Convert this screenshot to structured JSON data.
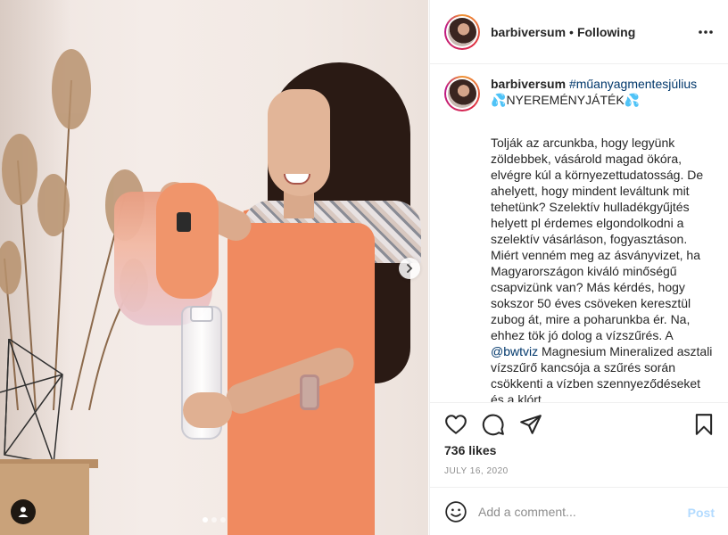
{
  "post": {
    "username": "barbiversum",
    "separator": "•",
    "follow_status": "Following",
    "hashtag": "#műanyagmentesjúlius",
    "drop_left": "💦",
    "contest": "NYEREMÉNYJÁTÉK",
    "drop_right": "💦",
    "caption_part1": "Tolják az arcunkba, hogy legyünk zöldebbek, vásárold magad ökóra, elvégre kúl a környezettudatosság. De ahelyett, hogy mindent leváltunk mit tehetünk? Szelektív hulladékgyűjtés helyett pl érdemes elgondolkodni a szelektív vásárláson, fogyasztáson. Miért venném meg az ásványvizet, ha Magyarországon kiváló minőségű csapvizünk van? Más kérdés, hogy sokszor 50 éves csöveken keresztül zubog át, mire a poharunkba ér. Na, ehhez tök jó dolog a vízszűrés. A ",
    "mention": "@bwtviz",
    "caption_part2": " Magnesium Mineralized asztali vízszűrő kancsója a szűrés során csökkenti a vízben szennyeződéseket és a klórt.",
    "likes": "736 likes",
    "date": "JULY 16, 2020"
  },
  "comment": {
    "placeholder": "Add a comment...",
    "post_label": "Post"
  },
  "carousel": {
    "count": 3,
    "active_index": 0
  },
  "colors": {
    "link": "#00376b",
    "muted": "#8e8e8e",
    "post_disabled": "#b3dbff",
    "border": "#efefef"
  },
  "icons": {
    "more": "more-dots-icon",
    "like": "heart-icon",
    "comment": "comment-bubble-icon",
    "share": "paper-plane-icon",
    "save": "bookmark-icon",
    "emoji": "emoji-icon",
    "next": "chevron-right-icon",
    "tagged": "user-tag-icon"
  }
}
